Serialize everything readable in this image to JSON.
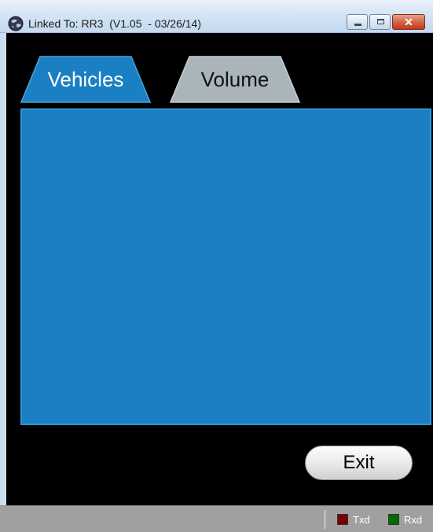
{
  "window": {
    "title": "Linked To: RR3  (V1.05  - 03/26/14)",
    "icon": "globe-icon",
    "controls": {
      "minimize": "minimize-icon",
      "maximize": "maximize-icon",
      "close": "close-icon"
    }
  },
  "tabs": [
    {
      "label": "Vehicles",
      "active": true,
      "color": "#1b80c3"
    },
    {
      "label": "Volume",
      "active": false,
      "color": "#a9b4bb"
    }
  ],
  "buttons": {
    "exit_label": "Exit"
  },
  "status": {
    "txd_label": "Txd",
    "txd_color": "#7a0000",
    "rxd_label": "Rxd",
    "rxd_color": "#006b00"
  }
}
